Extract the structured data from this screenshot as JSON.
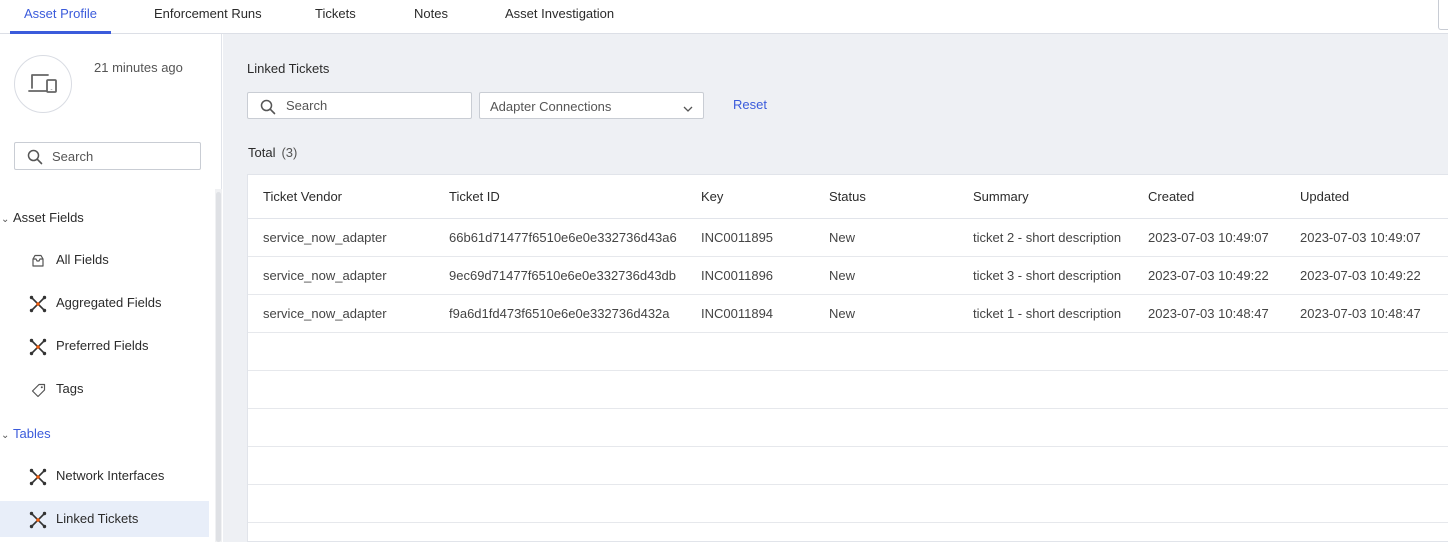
{
  "tabs": [
    {
      "label": "Asset Profile",
      "active": true
    },
    {
      "label": "Enforcement Runs",
      "active": false
    },
    {
      "label": "Tickets",
      "active": false
    },
    {
      "label": "Notes",
      "active": false
    },
    {
      "label": "Asset Investigation",
      "active": false
    }
  ],
  "colors": {
    "accent": "#3b5bdb",
    "main_bg": "#eef0f4",
    "active_item_bg": "#e8eef9"
  },
  "sidebar": {
    "device_icon": "device-icon",
    "timestamp": "21 minutes ago",
    "search_placeholder": "Search",
    "sections": [
      {
        "label": "Asset Fields",
        "items": [
          {
            "label": "All Fields",
            "icon": "inbox-icon"
          },
          {
            "label": "Aggregated Fields",
            "icon": "adapter-icon"
          },
          {
            "label": "Preferred Fields",
            "icon": "adapter-icon"
          },
          {
            "label": "Tags",
            "icon": "tag-icon"
          }
        ]
      },
      {
        "label": "Tables",
        "items": [
          {
            "label": "Network Interfaces",
            "icon": "adapter-icon"
          },
          {
            "label": "Linked Tickets",
            "icon": "adapter-icon",
            "active": true
          }
        ]
      }
    ]
  },
  "main": {
    "title": "Linked Tickets",
    "search_placeholder": "Search",
    "adapter_select": "Adapter Connections",
    "reset_label": "Reset",
    "total_label": "Total",
    "total_count": "(3)",
    "table": {
      "columns": [
        "Ticket Vendor",
        "Ticket ID",
        "Key",
        "Status",
        "Summary",
        "Created",
        "Updated"
      ],
      "rows": [
        [
          "service_now_adapter",
          "66b61d71477f6510e6e0e332736d43a6",
          "INC0011895",
          "New",
          "ticket 2 - short description",
          "2023-07-03 10:49:07",
          "2023-07-03 10:49:07"
        ],
        [
          "service_now_adapter",
          "9ec69d71477f6510e6e0e332736d43db",
          "INC0011896",
          "New",
          "ticket 3 - short description",
          "2023-07-03 10:49:22",
          "2023-07-03 10:49:22"
        ],
        [
          "service_now_adapter",
          "f9a6d1fd473f6510e6e0e332736d432a",
          "INC0011894",
          "New",
          "ticket 1 - short description",
          "2023-07-03 10:48:47",
          "2023-07-03 10:48:47"
        ]
      ]
    }
  }
}
